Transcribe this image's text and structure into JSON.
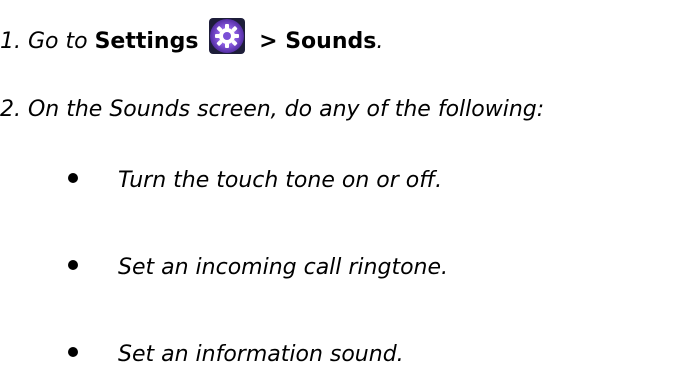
{
  "steps": {
    "step1": {
      "prefix": "1. Go to ",
      "settings": "Settings",
      "icon": "settings-gear-icon",
      "separator": " > ",
      "sounds": "Sounds",
      "suffix": "."
    },
    "step2": {
      "text": "2. On the Sounds screen, do any of the following:"
    }
  },
  "bullets": [
    {
      "text": "Turn the touch tone on or off."
    },
    {
      "text": "Set an incoming call ringtone."
    },
    {
      "text": "Set an information sound."
    }
  ],
  "colors": {
    "icon_bg": "#6a3fc9",
    "icon_glow": "#b98bff",
    "text": "#000000"
  }
}
